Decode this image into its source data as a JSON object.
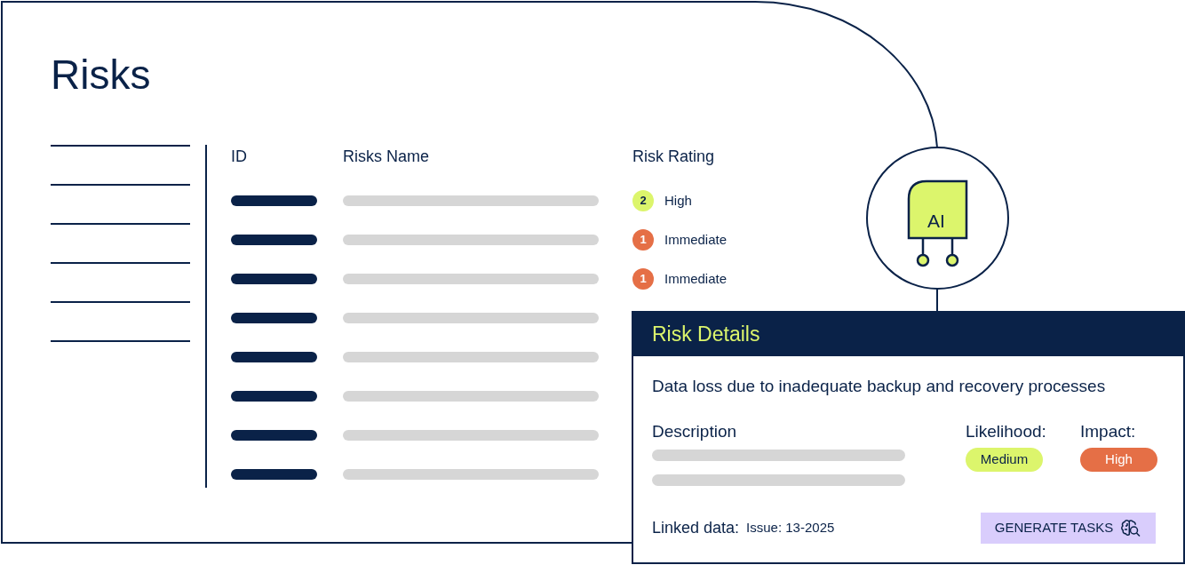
{
  "page": {
    "title": "Risks"
  },
  "table": {
    "columns": [
      "ID",
      "Risks Name",
      "Risk Rating"
    ],
    "rows": [
      {
        "kind": "rated",
        "rating": {
          "count": "2",
          "label": "High",
          "color": "#dcf56c"
        }
      },
      {
        "kind": "rated",
        "rating": {
          "count": "1",
          "label": "Immediate",
          "color": "#e56f46"
        }
      },
      {
        "kind": "rated",
        "rating": {
          "count": "1",
          "label": "Immediate",
          "color": "#e56f46"
        }
      },
      {
        "kind": "placeholder"
      },
      {
        "kind": "placeholder"
      },
      {
        "kind": "placeholder"
      },
      {
        "kind": "placeholder"
      },
      {
        "kind": "placeholder"
      }
    ]
  },
  "ai_badge": {
    "label": "AI"
  },
  "risk_details": {
    "title": "Risk Details",
    "risk_name": "Data loss due to inadequate backup and recovery processes",
    "description_label": "Description",
    "likelihood": {
      "label": "Likelihood:",
      "value": "Medium",
      "color": "#dcf56c"
    },
    "impact": {
      "label": "Impact:",
      "value": "High",
      "color": "#e56f46"
    },
    "linked_data": {
      "label": "Linked data:",
      "value": "Issue: 13-2025"
    },
    "button": "GENERATE TASKS"
  }
}
